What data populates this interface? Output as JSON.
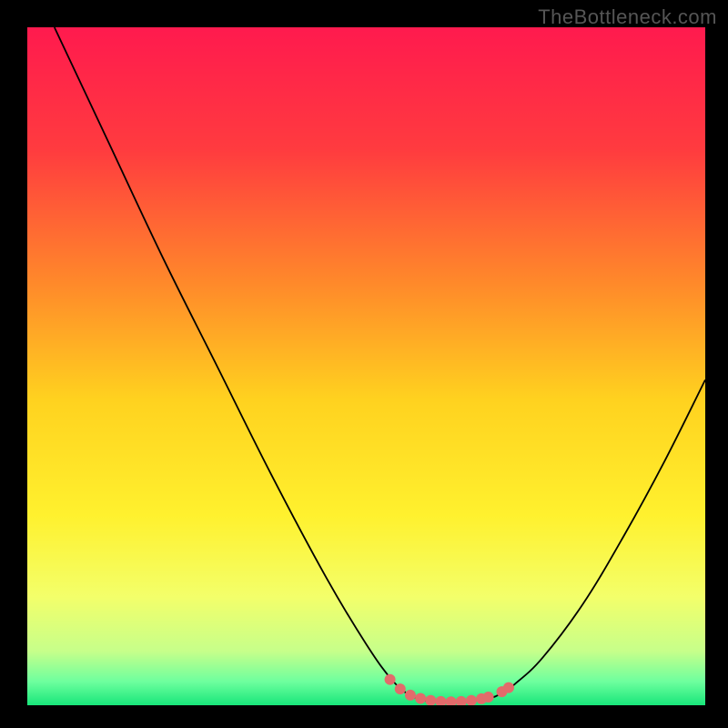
{
  "watermark": "TheBottleneck.com",
  "chart_data": {
    "type": "line",
    "title": "",
    "xlabel": "",
    "ylabel": "",
    "xlim": [
      0,
      100
    ],
    "ylim": [
      0,
      100
    ],
    "background_gradient": {
      "stops": [
        {
          "offset": 0.0,
          "color": "#ff1a4e"
        },
        {
          "offset": 0.18,
          "color": "#ff3b3f"
        },
        {
          "offset": 0.38,
          "color": "#ff8a2a"
        },
        {
          "offset": 0.55,
          "color": "#ffd21f"
        },
        {
          "offset": 0.72,
          "color": "#fff12e"
        },
        {
          "offset": 0.84,
          "color": "#f3ff6a"
        },
        {
          "offset": 0.92,
          "color": "#c7ff8a"
        },
        {
          "offset": 0.965,
          "color": "#6eff9e"
        },
        {
          "offset": 1.0,
          "color": "#18e67a"
        }
      ]
    },
    "series": [
      {
        "name": "bottleneck-curve",
        "color": "#000000",
        "width": 1.8,
        "points": [
          {
            "x": 4,
            "y": 100
          },
          {
            "x": 12,
            "y": 83
          },
          {
            "x": 20,
            "y": 66
          },
          {
            "x": 28,
            "y": 50
          },
          {
            "x": 36,
            "y": 34
          },
          {
            "x": 44,
            "y": 19
          },
          {
            "x": 50,
            "y": 9
          },
          {
            "x": 54,
            "y": 3.5
          },
          {
            "x": 57,
            "y": 1.2
          },
          {
            "x": 60,
            "y": 0.5
          },
          {
            "x": 64,
            "y": 0.5
          },
          {
            "x": 68,
            "y": 1.0
          },
          {
            "x": 70,
            "y": 1.8
          },
          {
            "x": 72,
            "y": 3.2
          },
          {
            "x": 76,
            "y": 7
          },
          {
            "x": 82,
            "y": 15
          },
          {
            "x": 88,
            "y": 25
          },
          {
            "x": 94,
            "y": 36
          },
          {
            "x": 100,
            "y": 48
          }
        ]
      },
      {
        "name": "optimal-range-marker",
        "color": "#e26b6b",
        "type": "marker",
        "radius": 6,
        "points": [
          {
            "x": 53.5,
            "y": 3.8
          },
          {
            "x": 55.0,
            "y": 2.4
          },
          {
            "x": 56.5,
            "y": 1.5
          },
          {
            "x": 58.0,
            "y": 1.0
          },
          {
            "x": 59.5,
            "y": 0.7
          },
          {
            "x": 61.0,
            "y": 0.55
          },
          {
            "x": 62.5,
            "y": 0.5
          },
          {
            "x": 64.0,
            "y": 0.55
          },
          {
            "x": 65.5,
            "y": 0.7
          },
          {
            "x": 67.0,
            "y": 0.95
          },
          {
            "x": 68.0,
            "y": 1.2
          },
          {
            "x": 70.0,
            "y": 2.0
          },
          {
            "x": 71.0,
            "y": 2.6
          }
        ]
      }
    ]
  }
}
